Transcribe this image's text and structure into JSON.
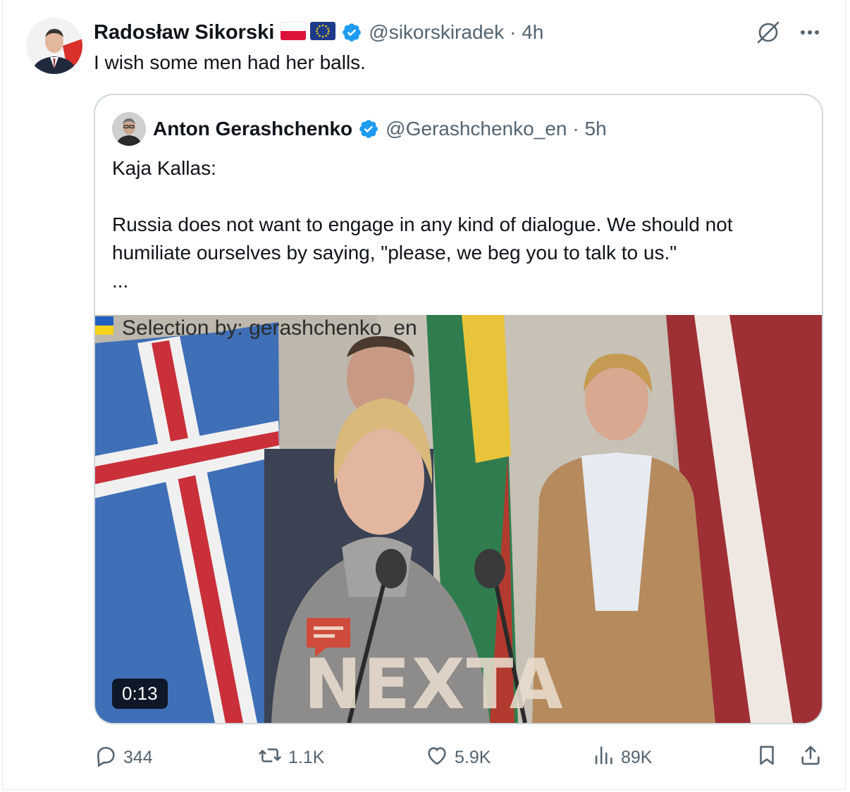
{
  "tweet": {
    "author_name": "Radosław Sikorski",
    "handle": "@sikorskiradek",
    "time": "· 4h",
    "text": "I wish some men had her balls."
  },
  "quoted": {
    "author_name": "Anton Gerashchenko",
    "handle": "@Gerashchenko_en",
    "time": "· 5h",
    "lines": [
      "Kaja Kallas:",
      "",
      "Russia does not want to engage in any kind of dialogue. We should not",
      "humiliate ourselves by saying, \"please, we beg you to talk to us.\"",
      "..."
    ],
    "video": {
      "overlay_text": "Selection by: gerashchenko_en",
      "watermark": "NEXTA",
      "duration": "0:13"
    }
  },
  "stats": {
    "replies": "344",
    "reposts": "1.1K",
    "likes": "5.9K",
    "views": "89K"
  },
  "colors": {
    "verified": "#1d9bf0",
    "text_primary": "#0f1419",
    "text_secondary": "#536471",
    "border": "#cfd9de"
  },
  "icons": [
    "flag-poland-icon",
    "flag-eu-icon",
    "verified-badge-icon",
    "grok-icon",
    "more-icon",
    "reply-icon",
    "repost-icon",
    "like-icon",
    "views-icon",
    "bookmark-icon",
    "share-icon"
  ]
}
